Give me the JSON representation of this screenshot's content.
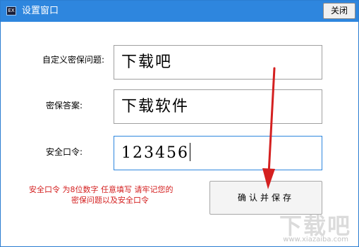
{
  "window": {
    "title": "设置窗口",
    "icon": "app-logo-icon",
    "icon_text": "EX",
    "close_label": "关闭",
    "accent": "#2e86de"
  },
  "form": {
    "question_label": "自定义密保问题:",
    "question_value": "下载吧",
    "answer_label": "密保答案:",
    "answer_value": "下载软件",
    "password_label": "安全口令:",
    "password_value": "123456"
  },
  "hint": {
    "line1": "安全口令 为8位数字 任意填写 请牢记您的",
    "line2": "密保问题以及安全口令",
    "color": "#d42020"
  },
  "actions": {
    "confirm_label": "确认并保存"
  },
  "annotation": {
    "arrow_color": "#d42020",
    "icon": "arrow-down-icon"
  },
  "watermark": {
    "text": "下载吧",
    "url": "www.xiazaiba.com"
  }
}
